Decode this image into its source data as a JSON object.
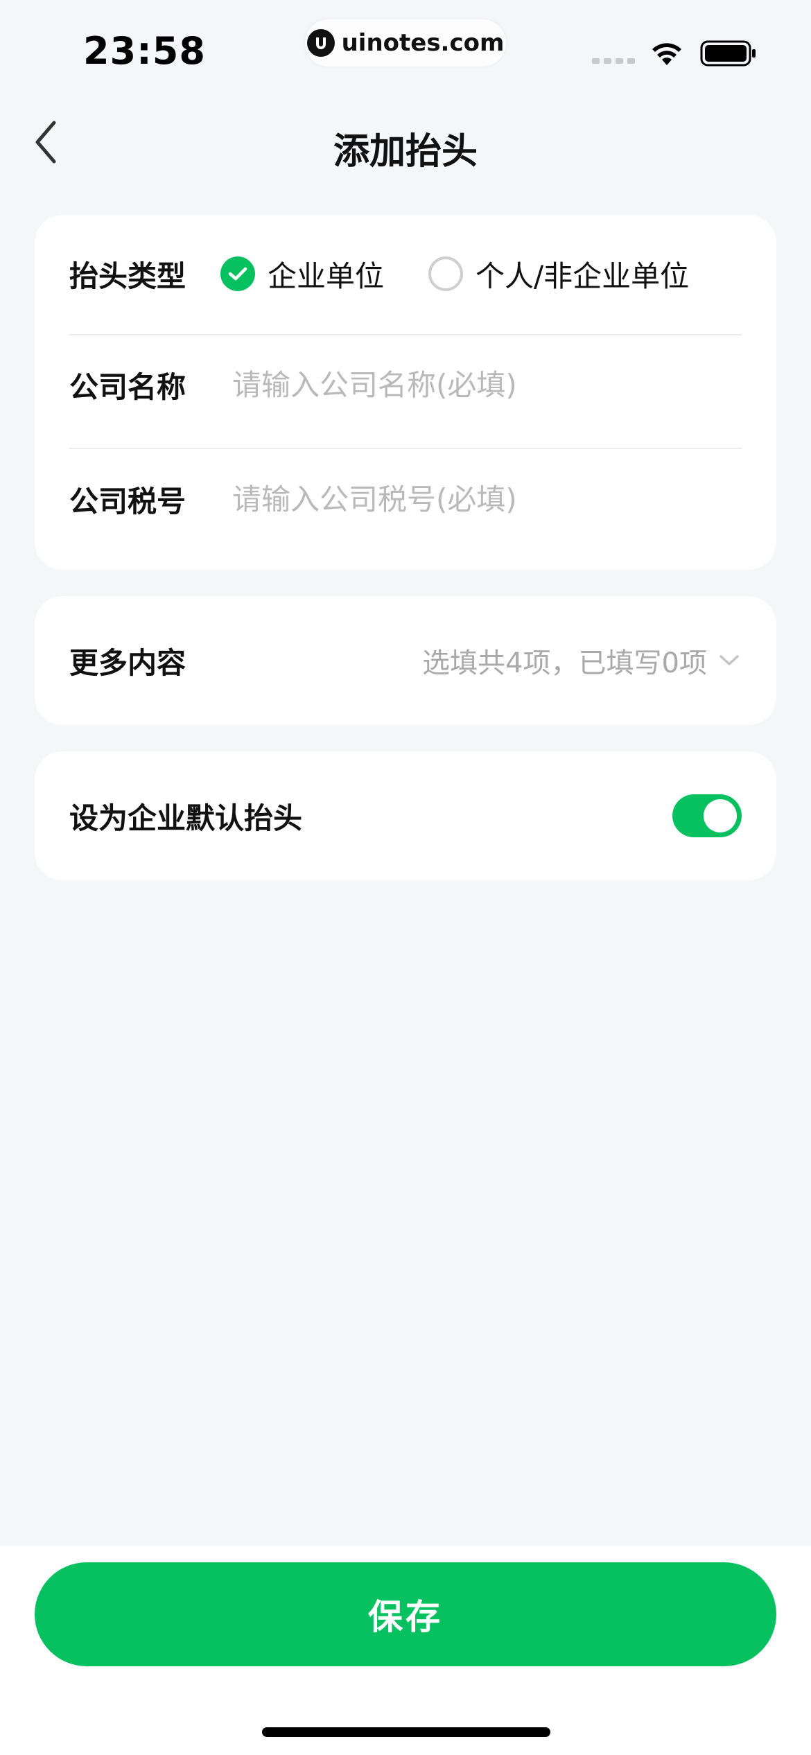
{
  "status_bar": {
    "time": "23:58",
    "watermark": "uinotes.com"
  },
  "nav": {
    "title": "添加抬头"
  },
  "form": {
    "type_label": "抬头类型",
    "type_options": [
      {
        "label": "企业单位",
        "checked": true
      },
      {
        "label": "个人/非企业单位",
        "checked": false
      }
    ],
    "company_name_label": "公司名称",
    "company_name_placeholder": "请输入公司名称(必填)",
    "company_name_value": "",
    "tax_id_label": "公司税号",
    "tax_id_placeholder": "请输入公司税号(必填)",
    "tax_id_value": ""
  },
  "more": {
    "label": "更多内容",
    "value": "选填共4项，已填写0项"
  },
  "default_setting": {
    "label": "设为企业默认抬头",
    "enabled": true
  },
  "footer": {
    "save_label": "保存"
  },
  "colors": {
    "accent": "#07c160",
    "background": "#f5f6f8",
    "placeholder": "#b9b9b9"
  },
  "icons": {
    "back": "chevron-left-icon",
    "more": "chevron-down-icon",
    "checked": "checkmark-icon",
    "wifi": "wifi-icon",
    "battery": "battery-icon"
  }
}
